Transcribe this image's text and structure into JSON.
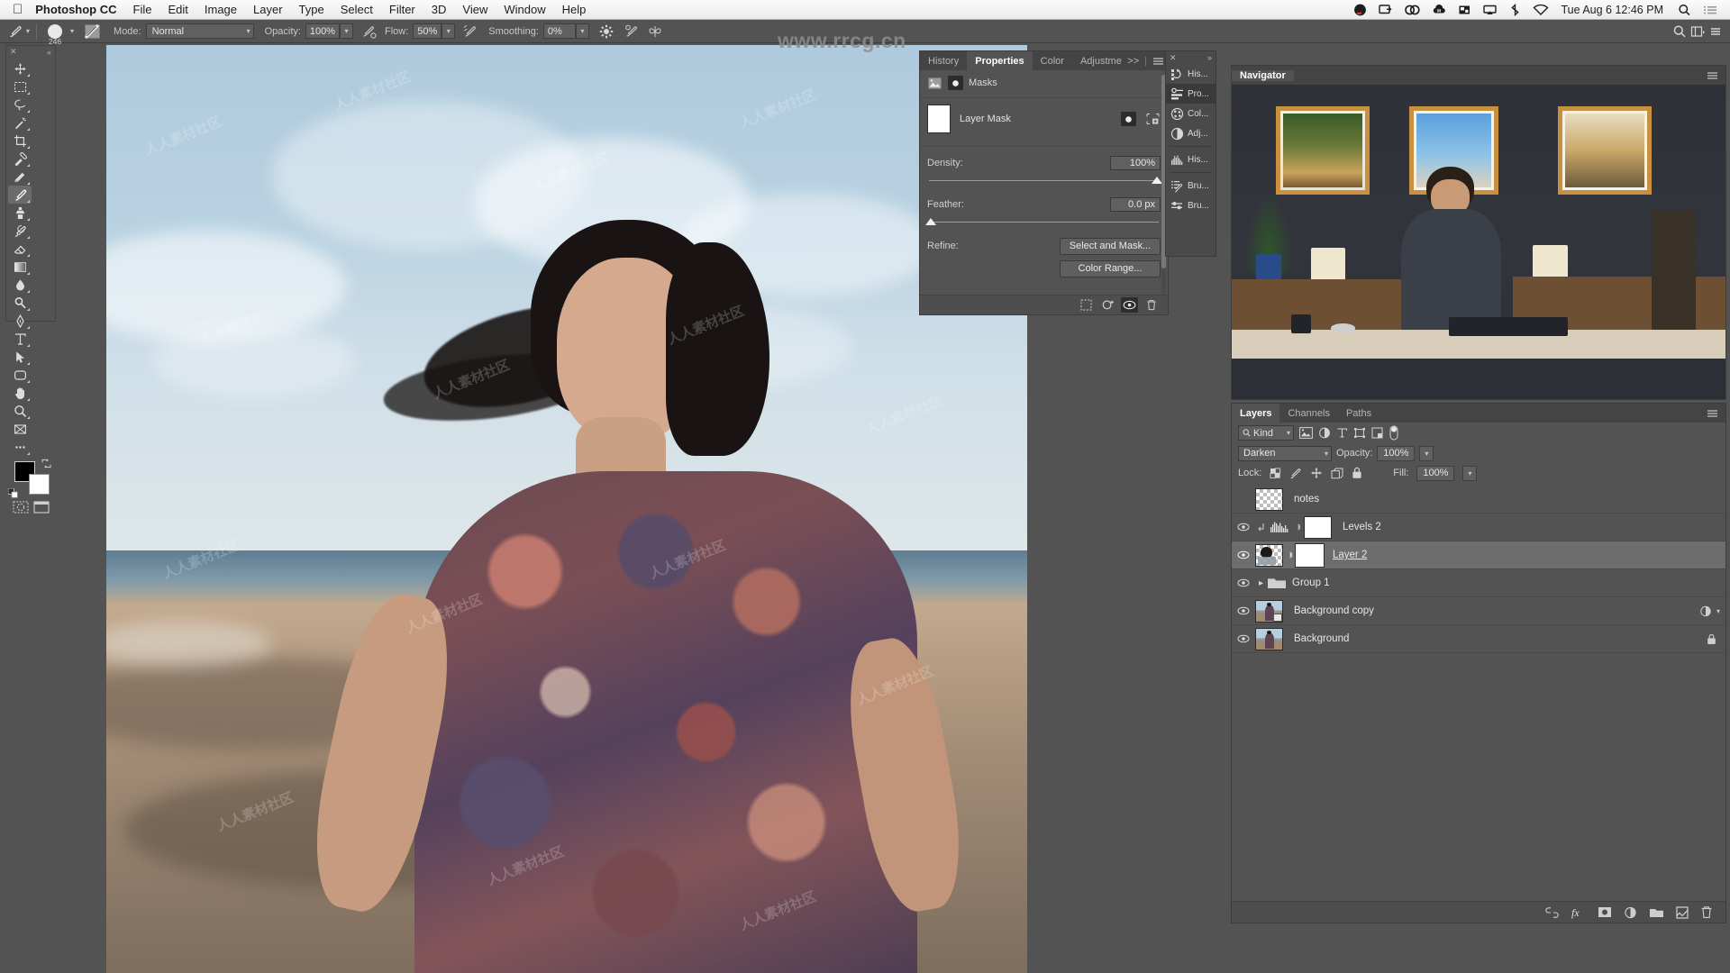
{
  "macbar": {
    "apple_icon": "apple-logo-icon",
    "app_name": "Photoshop CC",
    "menus": [
      "File",
      "Edit",
      "Image",
      "Layer",
      "Type",
      "Select",
      "Filter",
      "3D",
      "View",
      "Window",
      "Help"
    ],
    "status_icons": [
      "dropbox-icon",
      "screen-share-icon",
      "creative-cloud-icon",
      "cloud-icon",
      "display-icon",
      "airplay-icon",
      "bluetooth-icon",
      "wifi-icon"
    ],
    "clock": "Tue Aug 6  12:46 PM",
    "spotlight_icon": "search-icon",
    "control_center_icon": "menu-list-icon"
  },
  "options_bar": {
    "tool_preset_icon": "brush-tool-icon",
    "brush_size": "246",
    "brush_preset_icon": "brush-preset-icon",
    "mode_label": "Mode:",
    "mode_value": "Normal",
    "opacity_label": "Opacity:",
    "opacity_value": "100%",
    "pressure_opacity_icon": "pressure-opacity-icon",
    "flow_label": "Flow:",
    "flow_value": "50%",
    "airbrush_icon": "airbrush-icon",
    "smoothing_label": "Smoothing:",
    "smoothing_value": "0%",
    "smoothing_options_icon": "gear-icon",
    "angle_icon": "brush-angle-icon",
    "symmetry_icon": "symmetry-butterfly-icon",
    "tablet_pressure_size_icon": "tablet-pressure-size-icon",
    "search_icon": "search-icon",
    "workspace_icon": "workspace-switcher-icon",
    "arrange_icon": "arrange-documents-icon",
    "watermark": "www.rrcg.cn"
  },
  "toolbar": {
    "close_icon": "close-icon",
    "collapse_icon": "collapse-double-chevron-icon",
    "tools": [
      {
        "name": "move-tool",
        "glyph": "move"
      },
      {
        "name": "rectangular-marquee-tool",
        "glyph": "marquee"
      },
      {
        "name": "lasso-tool",
        "glyph": "lasso"
      },
      {
        "name": "magic-wand-tool",
        "glyph": "wand"
      },
      {
        "name": "crop-tool",
        "glyph": "crop"
      },
      {
        "name": "eyedropper-tool",
        "glyph": "eyedropper"
      },
      {
        "name": "spot-healing-brush-tool",
        "glyph": "healing"
      },
      {
        "name": "brush-tool",
        "glyph": "brush"
      },
      {
        "name": "clone-stamp-tool",
        "glyph": "stamp"
      },
      {
        "name": "history-brush-tool",
        "glyph": "historybrush"
      },
      {
        "name": "eraser-tool",
        "glyph": "eraser"
      },
      {
        "name": "gradient-tool",
        "glyph": "gradient"
      },
      {
        "name": "blur-tool",
        "glyph": "blur"
      },
      {
        "name": "dodge-tool",
        "glyph": "dodge"
      },
      {
        "name": "pen-tool",
        "glyph": "pen"
      },
      {
        "name": "horizontal-type-tool",
        "glyph": "type"
      },
      {
        "name": "path-selection-tool",
        "glyph": "pathselect"
      },
      {
        "name": "rounded-rectangle-tool",
        "glyph": "shape"
      },
      {
        "name": "hand-tool",
        "glyph": "hand"
      },
      {
        "name": "zoom-tool",
        "glyph": "zoom"
      },
      {
        "name": "edit-toolbar-tool",
        "glyph": "editbar"
      },
      {
        "name": "more-tools",
        "glyph": "ellipsis"
      }
    ],
    "selected_tool": "brush-tool",
    "foreground_color": "#000000",
    "background_color": "#ffffff",
    "swap_colors_icon": "swap-colors-icon",
    "default_colors_icon": "default-colors-icon",
    "quick_mask_icon": "quick-mask-icon",
    "screen_mode_icon": "screen-mode-icon"
  },
  "properties_panel": {
    "tabs": [
      {
        "label": "History",
        "active": false
      },
      {
        "label": "Properties",
        "active": true
      },
      {
        "label": "Color",
        "active": false
      },
      {
        "label": "Adjustme",
        "active": false
      }
    ],
    "overflow_icon": ">>",
    "menu_icon": "panel-menu-icon",
    "close_icon": "close-icon",
    "header_pixel_icon": "pixel-mask-icon",
    "header_vector_icon": "vector-mask-icon",
    "header_title": "Masks",
    "mask_thumb_label": "Layer Mask",
    "mask_select_icon": "select-mask-icon",
    "mask_from_selection_icon": "mask-from-selection-icon",
    "density_label": "Density:",
    "density_value": "100%",
    "density_percent": 100,
    "feather_label": "Feather:",
    "feather_value": "0.0 px",
    "feather_percent": 0,
    "refine_label": "Refine:",
    "select_and_mask_button": "Select and Mask...",
    "color_range_button": "Color Range...",
    "footer_icons": [
      "load-selection-icon",
      "apply-mask-icon",
      "toggle-mask-icon",
      "delete-mask-icon"
    ]
  },
  "panel_dock": {
    "close_icon": "close-icon",
    "expand_icon": "expand-double-chevron-icon",
    "items": [
      {
        "label": "His...",
        "icon": "history-icon",
        "active": false,
        "group": 0
      },
      {
        "label": "Pro...",
        "icon": "properties-icon",
        "active": true,
        "group": 0
      },
      {
        "label": "Col...",
        "icon": "color-wheel-icon",
        "active": false,
        "group": 0
      },
      {
        "label": "Adj...",
        "icon": "adjustments-icon",
        "active": false,
        "group": 0
      },
      {
        "label": "His...",
        "icon": "histogram-icon",
        "active": false,
        "group": 1
      },
      {
        "label": "Bru...",
        "icon": "brush-settings-icon",
        "active": false,
        "group": 2
      },
      {
        "label": "Bru...",
        "icon": "brushes-icon",
        "active": false,
        "group": 2
      }
    ]
  },
  "navigator_panel": {
    "tab_label": "Navigator",
    "menu_icon": "panel-menu-icon",
    "collapse_icon": "collapse-double-chevron-icon",
    "content_description": "video-frame-instructor-at-desk"
  },
  "layers_panel": {
    "tabs": [
      {
        "label": "Layers",
        "active": true
      },
      {
        "label": "Channels",
        "active": false
      },
      {
        "label": "Paths",
        "active": false
      }
    ],
    "menu_icon": "panel-menu-icon",
    "filter_kind": "Kind",
    "filter_search_icon": "search-icon",
    "filter_icons": [
      "filter-pixel-icon",
      "filter-adjustment-icon",
      "filter-type-icon",
      "filter-shape-icon",
      "filter-smartobject-icon"
    ],
    "filter_toggle_icon": "filter-toggle-switch-icon",
    "blend_mode": "Darken",
    "opacity_label": "Opacity:",
    "opacity_value": "100%",
    "lock_label": "Lock:",
    "lock_icons": [
      "lock-transparency-icon",
      "lock-image-icon",
      "lock-position-icon",
      "lock-artboard-icon",
      "lock-all-icon"
    ],
    "fill_label": "Fill:",
    "fill_value": "100%",
    "rows": [
      {
        "name": "notes",
        "visible": false,
        "selected": false,
        "thumb": "transparent",
        "type": "pixel",
        "link": false,
        "locked": false,
        "effects": false
      },
      {
        "name": "Levels 2",
        "visible": true,
        "selected": false,
        "thumb": "white",
        "type": "adjustment",
        "link": true,
        "clipped": true,
        "locked": false,
        "effects": false
      },
      {
        "name": "Layer 2",
        "visible": true,
        "selected": true,
        "thumb": "transparent-art",
        "type": "pixel-mask",
        "link": true,
        "locked": false,
        "effects": false
      },
      {
        "name": "Group 1",
        "visible": true,
        "selected": false,
        "thumb": "folder",
        "type": "group",
        "link": false,
        "locked": false,
        "effects": false
      },
      {
        "name": "Background copy",
        "visible": true,
        "selected": false,
        "thumb": "photo",
        "type": "smart",
        "link": false,
        "locked": false,
        "effects": true
      },
      {
        "name": "Background",
        "visible": true,
        "selected": false,
        "thumb": "photo",
        "type": "pixel",
        "link": false,
        "locked": true,
        "effects": false
      }
    ],
    "footer_icons": [
      "link-layers-icon",
      "layer-style-fx-icon",
      "add-layer-mask-icon",
      "new-adjustment-layer-icon",
      "new-group-icon",
      "new-layer-icon",
      "delete-layer-icon"
    ]
  },
  "canvas": {
    "document_description": "woman-on-beach-photo",
    "watermark_text": "人人素材社区"
  }
}
